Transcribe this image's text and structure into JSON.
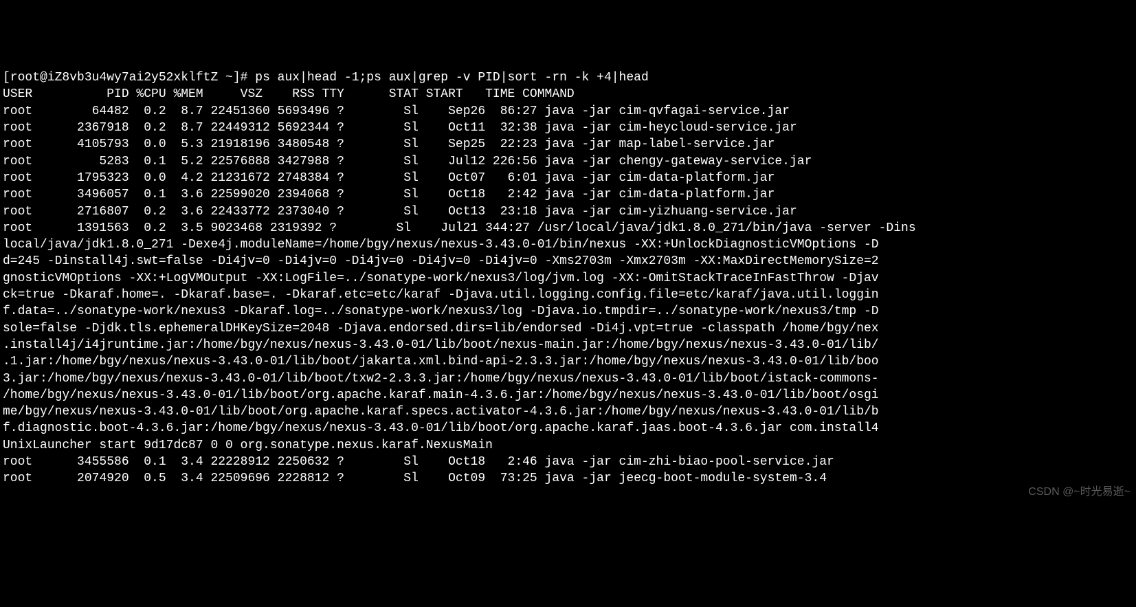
{
  "prompt": "[root@iZ8vb3u4wy7ai2y52xklftZ ~]# ",
  "command": "ps aux|head -1;ps aux|grep -v PID|sort -rn -k +4|head",
  "header": {
    "user": "USER",
    "pid": "PID",
    "cpu": "%CPU",
    "mem": "%MEM",
    "vsz": "VSZ",
    "rss": "RSS",
    "tty": "TTY",
    "stat": "STAT",
    "start": "START",
    "time": "TIME",
    "command": "COMMAND"
  },
  "rows": [
    {
      "user": "root",
      "pid": "64482",
      "cpu": "0.2",
      "mem": "8.7",
      "vsz": "22451360",
      "rss": "5693496",
      "tty": "?",
      "stat": "Sl",
      "start": "Sep26",
      "time": "86:27",
      "cmd": "java -jar cim-qvfagai-service.jar"
    },
    {
      "user": "root",
      "pid": "2367918",
      "cpu": "0.2",
      "mem": "8.7",
      "vsz": "22449312",
      "rss": "5692344",
      "tty": "?",
      "stat": "Sl",
      "start": "Oct11",
      "time": "32:38",
      "cmd": "java -jar cim-heycloud-service.jar"
    },
    {
      "user": "root",
      "pid": "4105793",
      "cpu": "0.0",
      "mem": "5.3",
      "vsz": "21918196",
      "rss": "3480548",
      "tty": "?",
      "stat": "Sl",
      "start": "Sep25",
      "time": "22:23",
      "cmd": "java -jar map-label-service.jar"
    },
    {
      "user": "root",
      "pid": "5283",
      "cpu": "0.1",
      "mem": "5.2",
      "vsz": "22576888",
      "rss": "3427988",
      "tty": "?",
      "stat": "Sl",
      "start": "Jul12",
      "time": "226:56",
      "cmd": "java -jar chengy-gateway-service.jar"
    },
    {
      "user": "root",
      "pid": "1795323",
      "cpu": "0.0",
      "mem": "4.2",
      "vsz": "21231672",
      "rss": "2748384",
      "tty": "?",
      "stat": "Sl",
      "start": "Oct07",
      "time": "6:01",
      "cmd": "java -jar cim-data-platform.jar"
    },
    {
      "user": "root",
      "pid": "3496057",
      "cpu": "0.1",
      "mem": "3.6",
      "vsz": "22599020",
      "rss": "2394068",
      "tty": "?",
      "stat": "Sl",
      "start": "Oct18",
      "time": "2:42",
      "cmd": "java -jar cim-data-platform.jar"
    },
    {
      "user": "root",
      "pid": "2716807",
      "cpu": "0.2",
      "mem": "3.6",
      "vsz": "22433772",
      "rss": "2373040",
      "tty": "?",
      "stat": "Sl",
      "start": "Oct13",
      "time": "23:18",
      "cmd": "java -jar cim-yizhuang-service.jar"
    }
  ],
  "long_row_prefix": {
    "user": "root",
    "pid": "1391563",
    "cpu": "0.2",
    "mem": "3.5",
    "vsz": "9023468",
    "rss": "2319392",
    "tty": "?",
    "stat": "Sl",
    "start": "Jul21",
    "time": "344:27"
  },
  "long_row_cmd_lines": [
    "/usr/local/java/jdk1.8.0_271/bin/java -server -Dins",
    "local/java/jdk1.8.0_271 -Dexe4j.moduleName=/home/bgy/nexus/nexus-3.43.0-01/bin/nexus -XX:+UnlockDiagnosticVMOptions -D",
    "d=245 -Dinstall4j.swt=false -Di4jv=0 -Di4jv=0 -Di4jv=0 -Di4jv=0 -Di4jv=0 -Xms2703m -Xmx2703m -XX:MaxDirectMemorySize=2",
    "gnosticVMOptions -XX:+LogVMOutput -XX:LogFile=../sonatype-work/nexus3/log/jvm.log -XX:-OmitStackTraceInFastThrow -Djav",
    "ck=true -Dkaraf.home=. -Dkaraf.base=. -Dkaraf.etc=etc/karaf -Djava.util.logging.config.file=etc/karaf/java.util.loggin",
    "f.data=../sonatype-work/nexus3 -Dkaraf.log=../sonatype-work/nexus3/log -Djava.io.tmpdir=../sonatype-work/nexus3/tmp -D",
    "sole=false -Djdk.tls.ephemeralDHKeySize=2048 -Djava.endorsed.dirs=lib/endorsed -Di4j.vpt=true -classpath /home/bgy/nex",
    ".install4j/i4jruntime.jar:/home/bgy/nexus/nexus-3.43.0-01/lib/boot/nexus-main.jar:/home/bgy/nexus/nexus-3.43.0-01/lib/",
    ".1.jar:/home/bgy/nexus/nexus-3.43.0-01/lib/boot/jakarta.xml.bind-api-2.3.3.jar:/home/bgy/nexus/nexus-3.43.0-01/lib/boo",
    "3.jar:/home/bgy/nexus/nexus-3.43.0-01/lib/boot/txw2-2.3.3.jar:/home/bgy/nexus/nexus-3.43.0-01/lib/boot/istack-commons-",
    "/home/bgy/nexus/nexus-3.43.0-01/lib/boot/org.apache.karaf.main-4.3.6.jar:/home/bgy/nexus/nexus-3.43.0-01/lib/boot/osgi",
    "me/bgy/nexus/nexus-3.43.0-01/lib/boot/org.apache.karaf.specs.activator-4.3.6.jar:/home/bgy/nexus/nexus-3.43.0-01/lib/b",
    "f.diagnostic.boot-4.3.6.jar:/home/bgy/nexus/nexus-3.43.0-01/lib/boot/org.apache.karaf.jaas.boot-4.3.6.jar com.install4",
    "UnixLauncher start 9d17dc87 0 0 org.sonatype.nexus.karaf.NexusMain"
  ],
  "tail_rows": [
    {
      "user": "root",
      "pid": "3455586",
      "cpu": "0.1",
      "mem": "3.4",
      "vsz": "22228912",
      "rss": "2250632",
      "tty": "?",
      "stat": "Sl",
      "start": "Oct18",
      "time": "2:46",
      "cmd": "java -jar cim-zhi-biao-pool-service.jar"
    },
    {
      "user": "root",
      "pid": "2074920",
      "cpu": "0.5",
      "mem": "3.4",
      "vsz": "22509696",
      "rss": "2228812",
      "tty": "?",
      "stat": "Sl",
      "start": "Oct09",
      "time": "73:25",
      "cmd": "java -jar jeecg-boot-module-system-3.4"
    }
  ],
  "watermark": "CSDN @~时光易逝~"
}
